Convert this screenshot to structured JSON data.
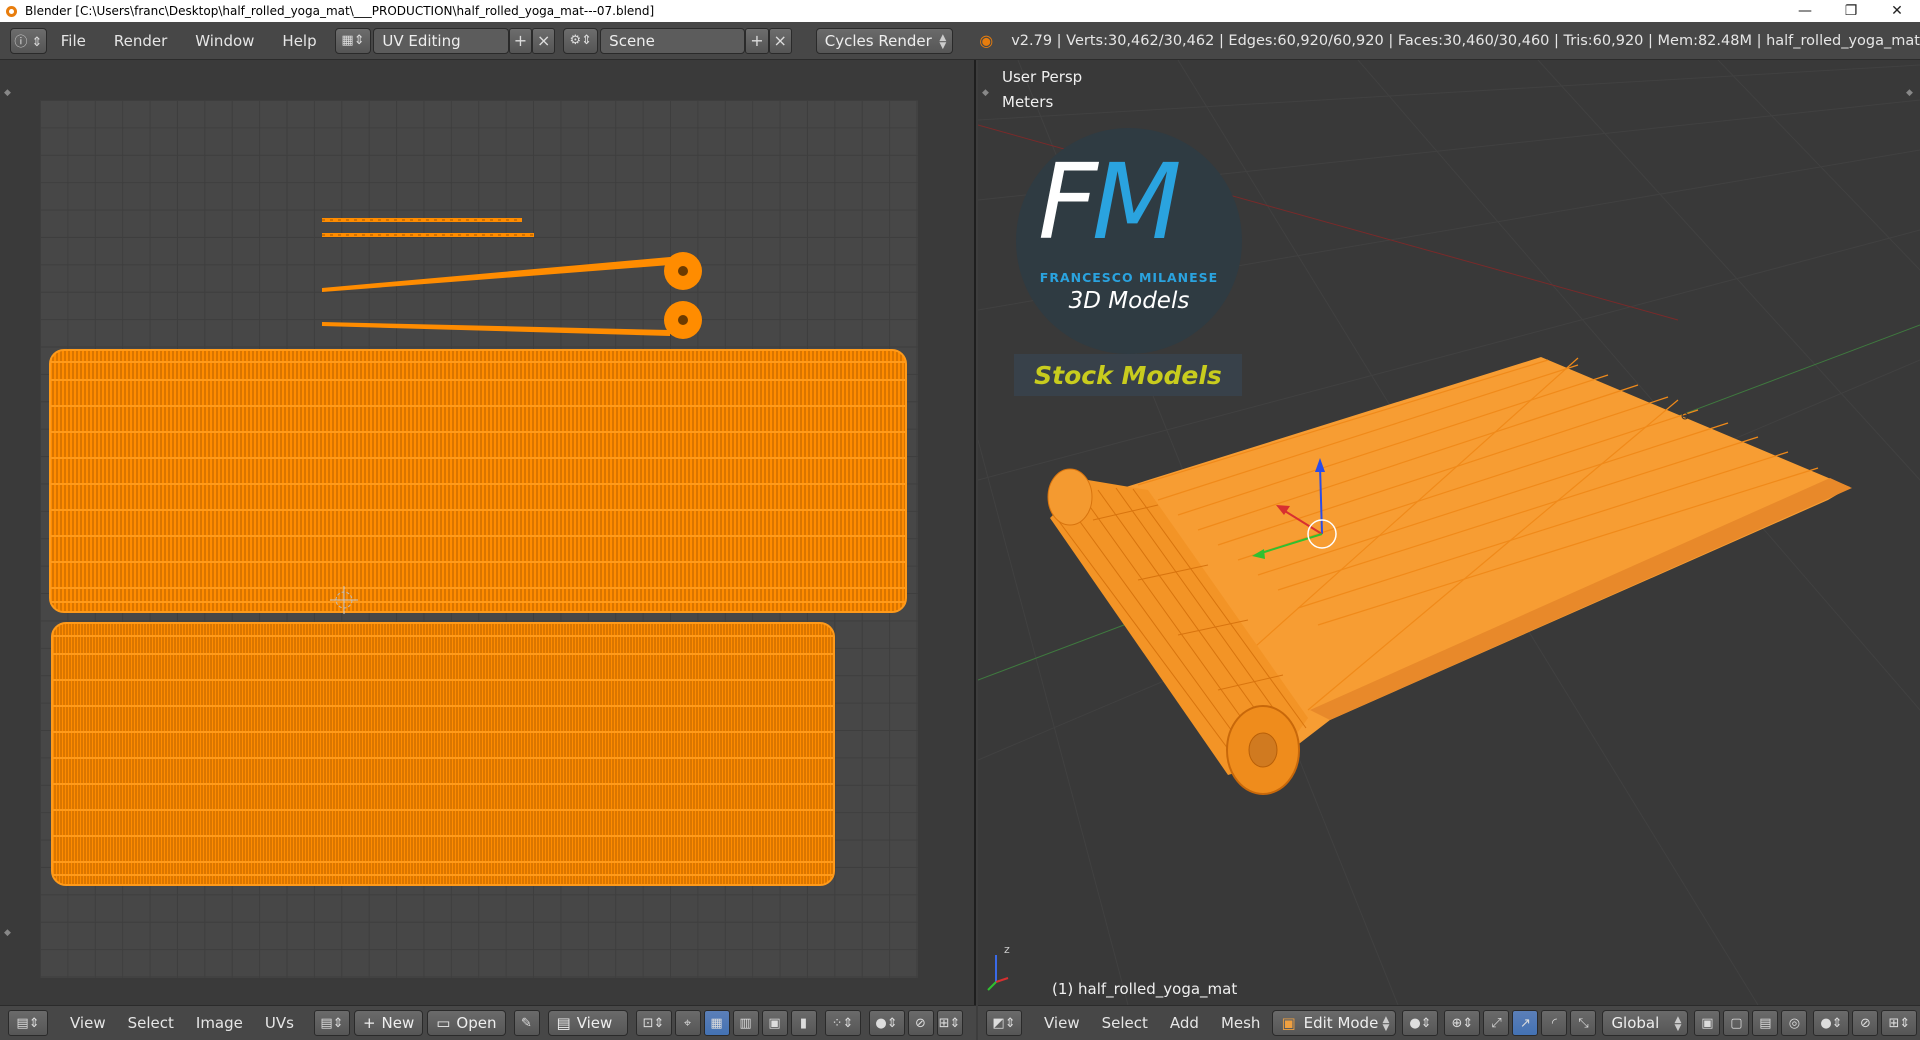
{
  "window": {
    "title": "Blender  [C:\\Users\\franc\\Desktop\\half_rolled_yoga_mat\\___PRODUCTION\\half_rolled_yoga_mat---07.blend]",
    "minimize": "—",
    "restore": "❐",
    "close": "✕"
  },
  "info_header": {
    "menus": [
      "File",
      "Render",
      "Window",
      "Help"
    ],
    "screen_layout": "UV Editing",
    "scene": "Scene",
    "render_engine": "Cycles Render",
    "stats": "v2.79 | Verts:30,462/30,462 | Edges:60,920/60,920 | Faces:30,460/30,460 | Tris:60,920 | Mem:82.48M | half_rolled_yoga_mat"
  },
  "viewport": {
    "view_name": "User Persp",
    "units": "Meters",
    "object_label": "(1) half_rolled_yoga_mat",
    "watermark": {
      "initials": "FM",
      "author": "FRANCESCO MILANESE",
      "tagline": "3D Models",
      "banner": "Stock Models"
    }
  },
  "uv_bottom": {
    "menus": [
      "View",
      "Select",
      "Image",
      "UVs"
    ],
    "new_label": "New",
    "open_label": "Open",
    "view_label": "View"
  },
  "v3d_bottom": {
    "menus": [
      "View",
      "Select",
      "Add",
      "Mesh"
    ],
    "mode": "Edit Mode",
    "orientation": "Global"
  },
  "colors": {
    "mesh_orange": "#ff8c00",
    "wire_orange": "#f57e00",
    "background": "#393939",
    "accent_yellow": "#c8cc1e",
    "logo_blue": "#2aa3df"
  }
}
